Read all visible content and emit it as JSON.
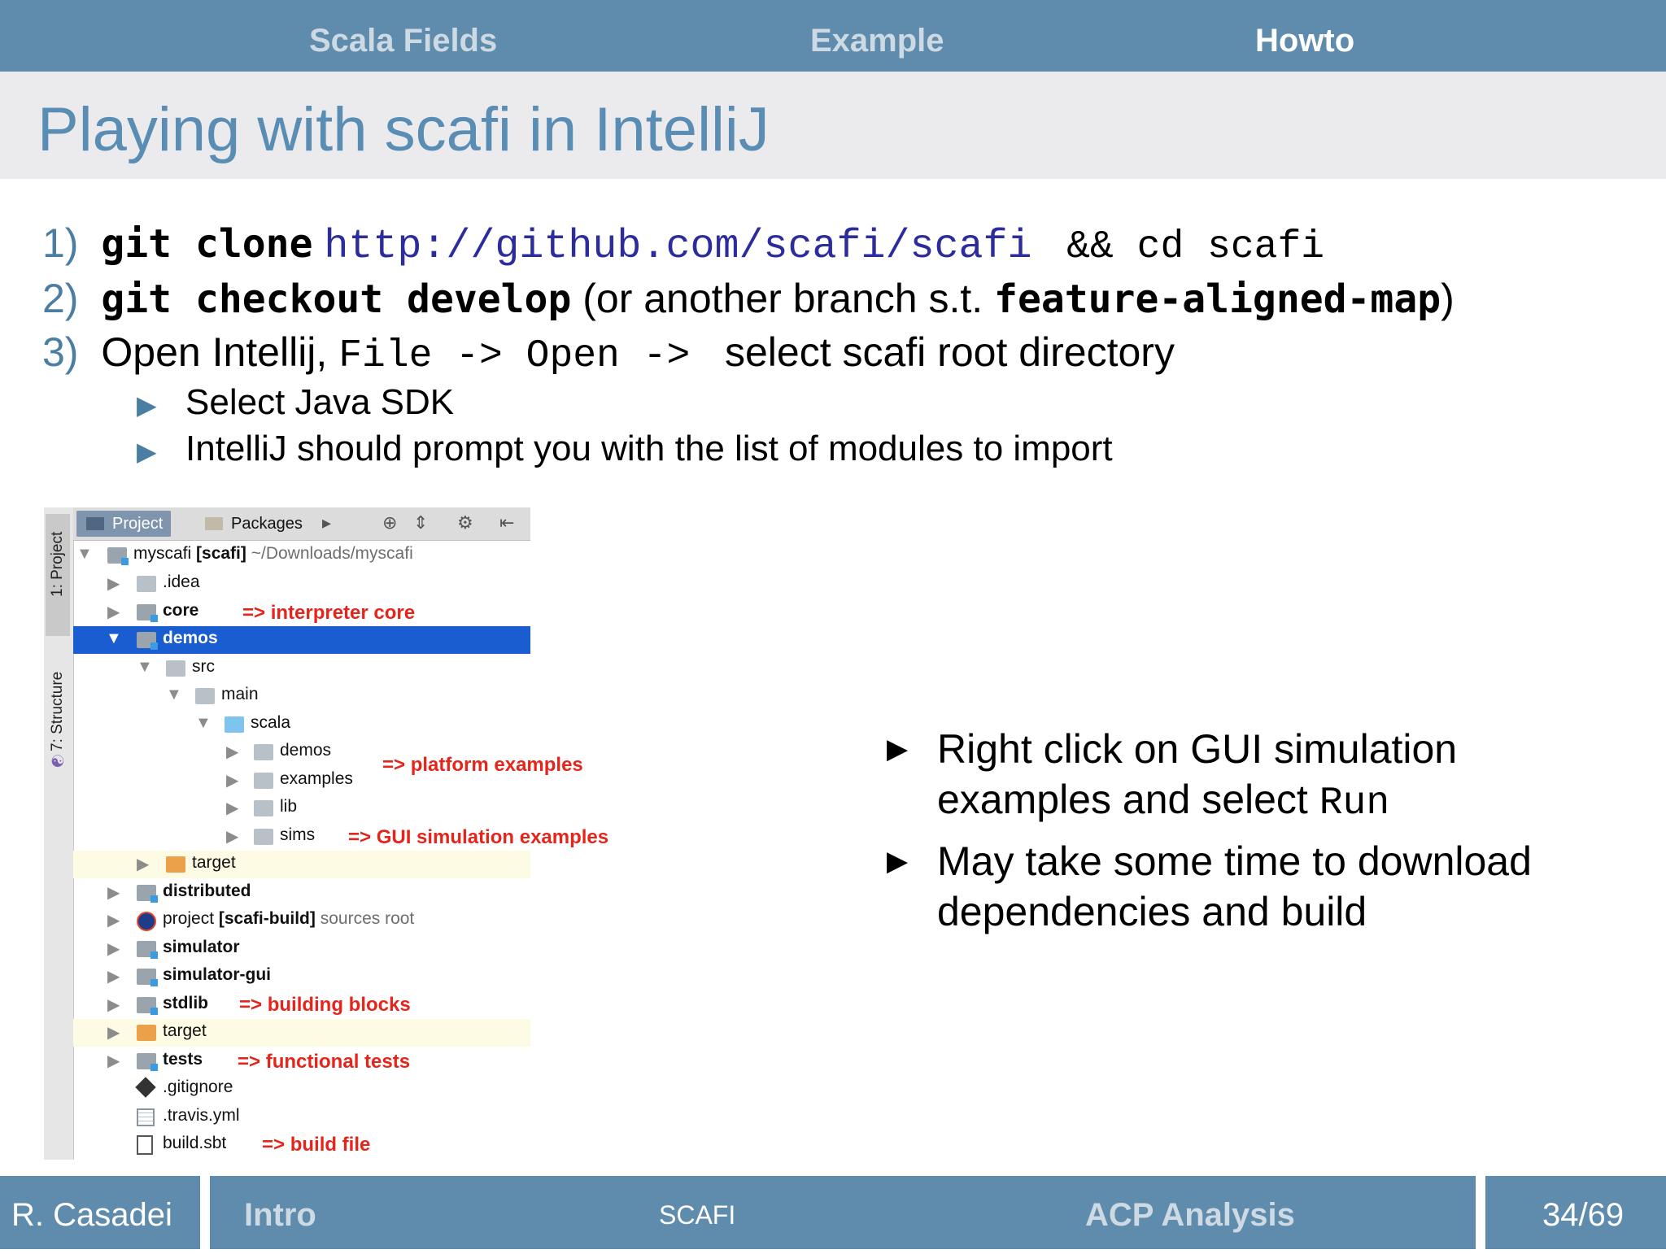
{
  "nav": {
    "items": [
      {
        "label": "Scala Fields",
        "active": false
      },
      {
        "label": "Example",
        "active": false
      },
      {
        "label": "Howto",
        "active": true
      }
    ]
  },
  "title": "Playing with scafi in IntelliJ",
  "steps": {
    "s1": {
      "num": "1)",
      "cmd": "git clone",
      "url": "http://github.com/scafi/scafi",
      "rest": " && cd scafi"
    },
    "s2": {
      "num": "2)",
      "cmd": "git checkout develop",
      "pre": " (or another branch s.t. ",
      "branch": "feature-aligned-map",
      "post": ")"
    },
    "s3": {
      "num": "3)",
      "pre": "Open Intellij, ",
      "menu": "File -> Open -> ",
      "post": " select scafi root directory"
    },
    "sub": [
      "Select Java SDK",
      "IntelliJ should prompt you with the list of modules to import"
    ]
  },
  "ide": {
    "side_tabs": [
      "1: Project",
      "7: Structure"
    ],
    "toolbar_tabs": [
      "Project",
      "Packages"
    ],
    "root": {
      "name": "myscafi",
      "module": "[scafi]",
      "path": "~/Downloads/myscafi"
    },
    "items": {
      "idea": ".idea",
      "core": "core",
      "demos": "demos",
      "src": "src",
      "main": "main",
      "scala": "scala",
      "demos2": "demos",
      "examples": "examples",
      "lib": "lib",
      "sims": "sims",
      "target1": "target",
      "distributed": "distributed",
      "project": "project",
      "project_module": "[scafi-build]",
      "project_note": "sources root",
      "simulator": "simulator",
      "simulator_gui": "simulator-gui",
      "stdlib": "stdlib",
      "target2": "target",
      "tests": "tests",
      "gitignore": ".gitignore",
      "travis": ".travis.yml",
      "buildsbt": "build.sbt"
    },
    "annotations": {
      "core": "=> interpreter core",
      "platform": "=> platform examples",
      "gui": "=> GUI simulation examples",
      "stdlib": "=> building blocks",
      "tests": "=> functional tests",
      "build": "=> build file"
    }
  },
  "right": {
    "b1_line1": "Right click on GUI simulation",
    "b1_line2_pre": "examples and select ",
    "b1_run": "Run",
    "b2_line1": "May take some time to download",
    "b2_line2": "dependencies and build"
  },
  "footer": {
    "author": "R. Casadei",
    "section": "Intro",
    "center": "SCAFI",
    "right_section": "ACP Analysis",
    "page": "34/69"
  }
}
